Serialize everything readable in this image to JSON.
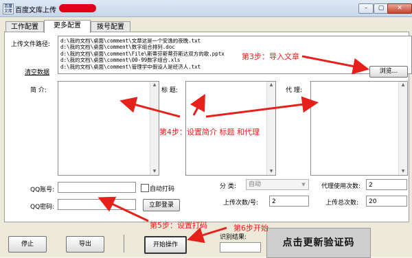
{
  "window": {
    "icon_text": "百度文库",
    "title": "百度文库上传",
    "minimize": "–",
    "maximize": "▢",
    "close": "✕"
  },
  "tabs": [
    {
      "label": "工作配置",
      "active": false
    },
    {
      "label": "更多配置",
      "active": true
    },
    {
      "label": "拨号配置",
      "active": false
    }
  ],
  "upload": {
    "path_label": "上传文件路径:",
    "clear_link": "清空数据",
    "files": [
      "d:\\我的文档\\桌面\\comment\\文章这是一个安逸的夜晚.txt",
      "d:\\我的文档\\桌面\\comment\\数字组合排列.doc",
      "d:\\我的文档\\桌面\\comment\\File\\斯蒂芬斯蒂芬斯达双方的歌.pptx",
      "d:\\我的文档\\桌面\\comment\\00-99数字组合.xls",
      "d:\\我的文档\\桌面\\comment\\管理学中假设人是经济人.txt"
    ],
    "browse_button": "浏览..."
  },
  "fields": {
    "intro_label": "简  介:",
    "title_label": "标  题:",
    "proxy_label": "代  理:"
  },
  "account": {
    "qq_label": "QQ账号:",
    "pwd_label": "QQ密码:",
    "auto_code_label": "自动打码",
    "login_button": "立即登录"
  },
  "settings": {
    "category_label": "分  类:",
    "category_value": "自动",
    "proxy_uses_label": "代理使用次数:",
    "proxy_uses_value": "2",
    "upload_per_label": "上传次数/号:",
    "upload_per_value": "2",
    "upload_total_label": "上传总次数:",
    "upload_total_value": "20"
  },
  "footer": {
    "stop_button": "停止",
    "export_button": "导出",
    "start_button": "开始操作",
    "result_label": "识别结果:",
    "captcha_text": "点击更新验证码"
  },
  "annotations": {
    "step3": "第3步：导入文章",
    "step4": "第4步：设置简介 标题 和代理",
    "step5": "第5步：设置打码",
    "step6": "第6步开始"
  },
  "colors": {
    "annotation": "#e8201c",
    "redaction": "#e0001b"
  }
}
